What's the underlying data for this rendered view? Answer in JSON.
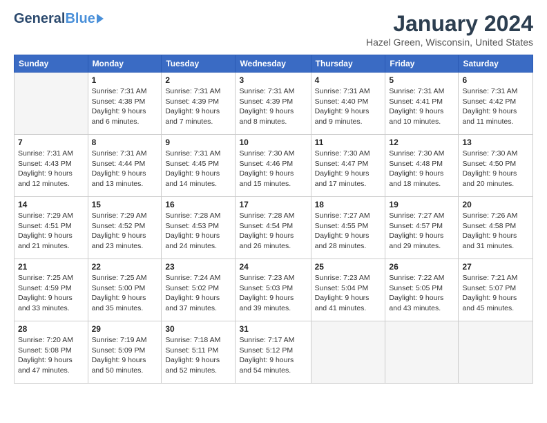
{
  "header": {
    "logo_general": "General",
    "logo_blue": "Blue",
    "month_title": "January 2024",
    "location": "Hazel Green, Wisconsin, United States"
  },
  "weekdays": [
    "Sunday",
    "Monday",
    "Tuesday",
    "Wednesday",
    "Thursday",
    "Friday",
    "Saturday"
  ],
  "weeks": [
    [
      {
        "day": "",
        "info": ""
      },
      {
        "day": "1",
        "info": "Sunrise: 7:31 AM\nSunset: 4:38 PM\nDaylight: 9 hours\nand 6 minutes."
      },
      {
        "day": "2",
        "info": "Sunrise: 7:31 AM\nSunset: 4:39 PM\nDaylight: 9 hours\nand 7 minutes."
      },
      {
        "day": "3",
        "info": "Sunrise: 7:31 AM\nSunset: 4:39 PM\nDaylight: 9 hours\nand 8 minutes."
      },
      {
        "day": "4",
        "info": "Sunrise: 7:31 AM\nSunset: 4:40 PM\nDaylight: 9 hours\nand 9 minutes."
      },
      {
        "day": "5",
        "info": "Sunrise: 7:31 AM\nSunset: 4:41 PM\nDaylight: 9 hours\nand 10 minutes."
      },
      {
        "day": "6",
        "info": "Sunrise: 7:31 AM\nSunset: 4:42 PM\nDaylight: 9 hours\nand 11 minutes."
      }
    ],
    [
      {
        "day": "7",
        "info": "Sunrise: 7:31 AM\nSunset: 4:43 PM\nDaylight: 9 hours\nand 12 minutes."
      },
      {
        "day": "8",
        "info": "Sunrise: 7:31 AM\nSunset: 4:44 PM\nDaylight: 9 hours\nand 13 minutes."
      },
      {
        "day": "9",
        "info": "Sunrise: 7:31 AM\nSunset: 4:45 PM\nDaylight: 9 hours\nand 14 minutes."
      },
      {
        "day": "10",
        "info": "Sunrise: 7:30 AM\nSunset: 4:46 PM\nDaylight: 9 hours\nand 15 minutes."
      },
      {
        "day": "11",
        "info": "Sunrise: 7:30 AM\nSunset: 4:47 PM\nDaylight: 9 hours\nand 17 minutes."
      },
      {
        "day": "12",
        "info": "Sunrise: 7:30 AM\nSunset: 4:48 PM\nDaylight: 9 hours\nand 18 minutes."
      },
      {
        "day": "13",
        "info": "Sunrise: 7:30 AM\nSunset: 4:50 PM\nDaylight: 9 hours\nand 20 minutes."
      }
    ],
    [
      {
        "day": "14",
        "info": "Sunrise: 7:29 AM\nSunset: 4:51 PM\nDaylight: 9 hours\nand 21 minutes."
      },
      {
        "day": "15",
        "info": "Sunrise: 7:29 AM\nSunset: 4:52 PM\nDaylight: 9 hours\nand 23 minutes."
      },
      {
        "day": "16",
        "info": "Sunrise: 7:28 AM\nSunset: 4:53 PM\nDaylight: 9 hours\nand 24 minutes."
      },
      {
        "day": "17",
        "info": "Sunrise: 7:28 AM\nSunset: 4:54 PM\nDaylight: 9 hours\nand 26 minutes."
      },
      {
        "day": "18",
        "info": "Sunrise: 7:27 AM\nSunset: 4:55 PM\nDaylight: 9 hours\nand 28 minutes."
      },
      {
        "day": "19",
        "info": "Sunrise: 7:27 AM\nSunset: 4:57 PM\nDaylight: 9 hours\nand 29 minutes."
      },
      {
        "day": "20",
        "info": "Sunrise: 7:26 AM\nSunset: 4:58 PM\nDaylight: 9 hours\nand 31 minutes."
      }
    ],
    [
      {
        "day": "21",
        "info": "Sunrise: 7:25 AM\nSunset: 4:59 PM\nDaylight: 9 hours\nand 33 minutes."
      },
      {
        "day": "22",
        "info": "Sunrise: 7:25 AM\nSunset: 5:00 PM\nDaylight: 9 hours\nand 35 minutes."
      },
      {
        "day": "23",
        "info": "Sunrise: 7:24 AM\nSunset: 5:02 PM\nDaylight: 9 hours\nand 37 minutes."
      },
      {
        "day": "24",
        "info": "Sunrise: 7:23 AM\nSunset: 5:03 PM\nDaylight: 9 hours\nand 39 minutes."
      },
      {
        "day": "25",
        "info": "Sunrise: 7:23 AM\nSunset: 5:04 PM\nDaylight: 9 hours\nand 41 minutes."
      },
      {
        "day": "26",
        "info": "Sunrise: 7:22 AM\nSunset: 5:05 PM\nDaylight: 9 hours\nand 43 minutes."
      },
      {
        "day": "27",
        "info": "Sunrise: 7:21 AM\nSunset: 5:07 PM\nDaylight: 9 hours\nand 45 minutes."
      }
    ],
    [
      {
        "day": "28",
        "info": "Sunrise: 7:20 AM\nSunset: 5:08 PM\nDaylight: 9 hours\nand 47 minutes."
      },
      {
        "day": "29",
        "info": "Sunrise: 7:19 AM\nSunset: 5:09 PM\nDaylight: 9 hours\nand 50 minutes."
      },
      {
        "day": "30",
        "info": "Sunrise: 7:18 AM\nSunset: 5:11 PM\nDaylight: 9 hours\nand 52 minutes."
      },
      {
        "day": "31",
        "info": "Sunrise: 7:17 AM\nSunset: 5:12 PM\nDaylight: 9 hours\nand 54 minutes."
      },
      {
        "day": "",
        "info": ""
      },
      {
        "day": "",
        "info": ""
      },
      {
        "day": "",
        "info": ""
      }
    ]
  ]
}
